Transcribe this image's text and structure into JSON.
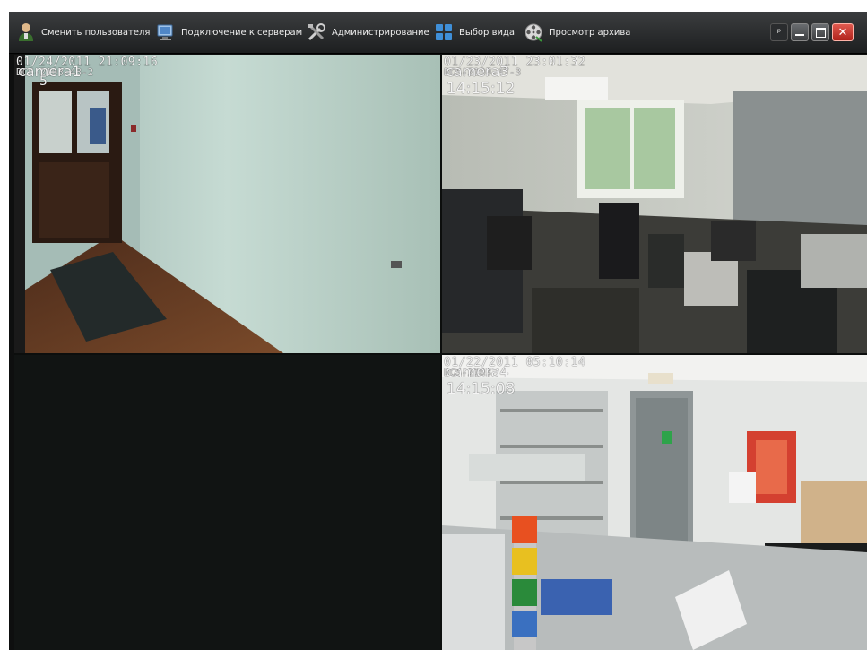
{
  "toolbar": {
    "items": [
      {
        "label": "Сменить пользователя",
        "icon": "user-icon"
      },
      {
        "label": "Подключение к серверам",
        "icon": "monitor-icon"
      },
      {
        "label": "Администрирование",
        "icon": "tools-icon"
      },
      {
        "label": "Выбор вида",
        "icon": "grid-layout-icon"
      },
      {
        "label": "Просмотр архива",
        "icon": "film-reel-icon"
      }
    ],
    "window_buttons": {
      "pin": "pin-icon",
      "minimize": "minimize-icon",
      "maximize": "maximize-icon",
      "close": "close-icon"
    }
  },
  "cameras": [
    {
      "timestamp": "01/24/2011 21:09:16",
      "subline": "DCS-2103-48-2",
      "name": "camera1",
      "time": "5"
    },
    {
      "timestamp": "01/23/2011 23:01:32",
      "subline": "DCS-2130-47-3",
      "name": "camera3",
      "time": "14:15:12"
    },
    {
      "timestamp": "",
      "subline": "",
      "name": "",
      "time": ""
    },
    {
      "timestamp": "01/22/2011 05:10:14",
      "subline": "DCS-2103",
      "name": "camera4",
      "time": "14:15:08"
    }
  ],
  "colors": {
    "toolbar": "#2c2e30",
    "background": "#0e0f0f",
    "close": "#c9302c",
    "empty_tile": "#111413"
  }
}
